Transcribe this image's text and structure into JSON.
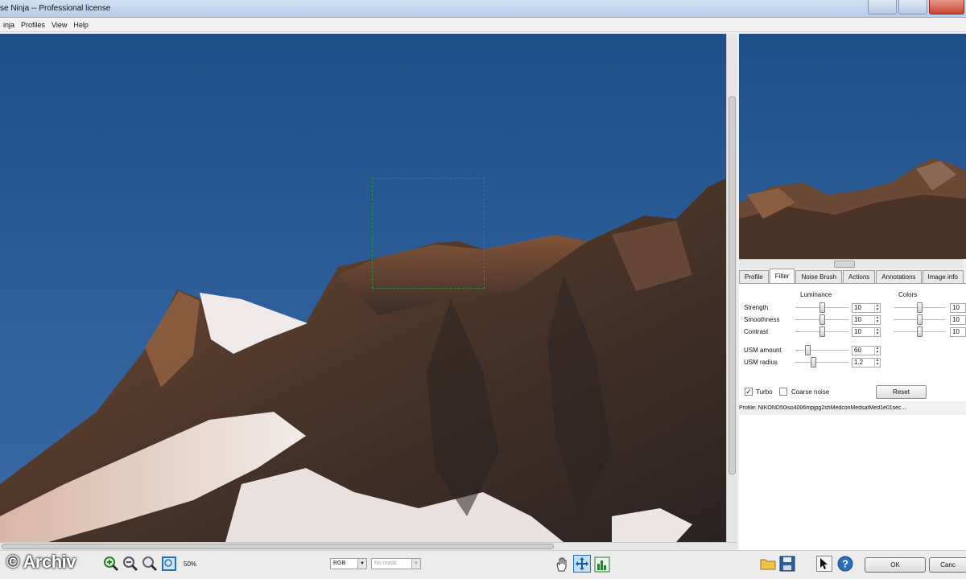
{
  "window": {
    "title": "se Ninja -- Professional license"
  },
  "menu": {
    "items": [
      "inja",
      "Profiles",
      "View",
      "Help"
    ]
  },
  "tabs": [
    {
      "label": "Profile",
      "active": false
    },
    {
      "label": "Filter",
      "active": true
    },
    {
      "label": "Noise Brush",
      "active": false
    },
    {
      "label": "Actions",
      "active": false
    },
    {
      "label": "Annotations",
      "active": false
    },
    {
      "label": "Image info",
      "active": false
    }
  ],
  "filter": {
    "luminance_label": "Luminance",
    "colors_label": "Colors",
    "rows": [
      {
        "label": "Strength",
        "lum_value": "10",
        "col_value": "10",
        "lum_level": 0.5,
        "col_level": 0.5
      },
      {
        "label": "Smoothness",
        "lum_value": "10",
        "col_value": "10",
        "lum_level": 0.5,
        "col_level": 0.5
      },
      {
        "label": "Contrast",
        "lum_value": "10",
        "col_value": "10",
        "lum_level": 0.5,
        "col_level": 0.5
      }
    ],
    "usm_amount": {
      "label": "USM amount",
      "value": "60",
      "level": 0.2
    },
    "usm_radius": {
      "label": "USM radius",
      "value": "1.2",
      "level": 0.33
    },
    "turbo": {
      "label": "Turbo",
      "checked": true
    },
    "coarse_noise": {
      "label": "Coarse noise",
      "checked": false
    },
    "reset_label": "Reset"
  },
  "profile_line": "Profile: NIKOND50iso4006mpjpg2shMedconMedsatMed1e01sec...",
  "bottom": {
    "zoom": "50%",
    "channel": "RGB",
    "mask": "No mask",
    "ok_label": "OK",
    "cancel_label": "Canc"
  },
  "watermark": "© Archiv",
  "colors": {
    "accent": "#2a6ebb",
    "selection": "#2f8a3a",
    "sky": "#2f5f9a"
  }
}
